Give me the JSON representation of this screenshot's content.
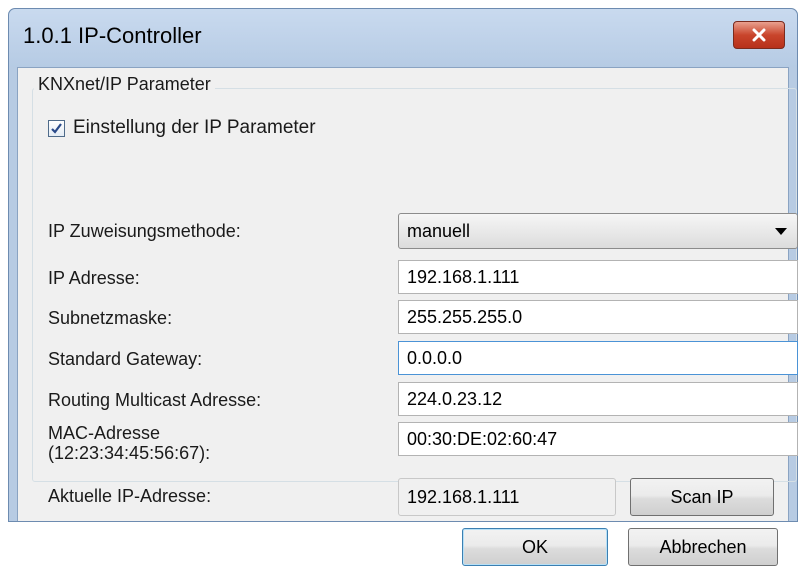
{
  "window": {
    "title": "1.0.1  IP-Controller"
  },
  "group": {
    "title": "KNXnet/IP Parameter",
    "checkbox_label": "Einstellung der IP Parameter",
    "checkbox_checked": true
  },
  "form": {
    "method_label": "IP Zuweisungsmethode:",
    "method_value": "manuell",
    "ip_label": "IP Adresse:",
    "ip_value": "192.168.1.111",
    "subnet_label": "Subnetzmaske:",
    "subnet_value": "255.255.255.0",
    "gateway_label": "Standard Gateway:",
    "gateway_value": "0.0.0.0",
    "multicast_label": "Routing Multicast Adresse:",
    "multicast_value": "224.0.23.12",
    "mac_label_line1": "MAC-Adresse",
    "mac_label_line2": "(12:23:34:45:56:67):",
    "mac_value": "00:30:DE:02:60:47",
    "current_ip_label": "Aktuelle IP-Adresse:",
    "current_ip_value": "192.168.1.111",
    "scan_label": "Scan IP"
  },
  "buttons": {
    "ok_label": "OK",
    "cancel_label": "Abbrechen"
  },
  "colors": {
    "close_button": "#c9452c",
    "frame": "#b7cbe3",
    "focus": "#4b93d6"
  }
}
